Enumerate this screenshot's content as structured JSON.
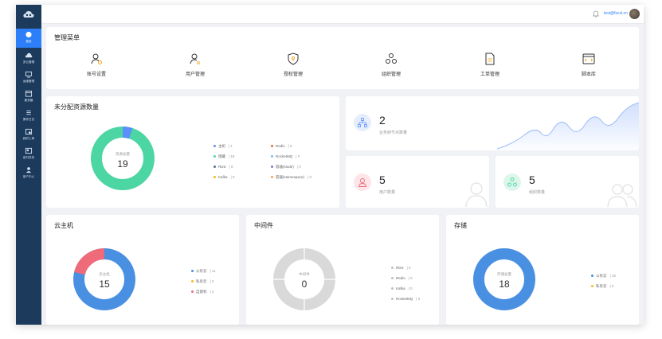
{
  "sidebar": {
    "items": [
      {
        "label": "首页",
        "icon": "home-icon",
        "active": true
      },
      {
        "label": "多云管理",
        "icon": "cloud-icon"
      },
      {
        "label": "运维管理",
        "icon": "monitor-icon"
      },
      {
        "label": "服务器",
        "icon": "calendar-icon"
      },
      {
        "label": "操作日志",
        "icon": "list-icon"
      },
      {
        "label": "我的工单",
        "icon": "ticket-icon"
      },
      {
        "label": "定时任务",
        "icon": "task-icon"
      },
      {
        "label": "用户中心",
        "icon": "user-icon"
      }
    ]
  },
  "header": {
    "username": "test@fscxl.cn"
  },
  "menu": {
    "title": "管理菜单",
    "items": [
      {
        "label": "账号设置",
        "icon": "account-settings-icon"
      },
      {
        "label": "用户管理",
        "icon": "user-manage-icon"
      },
      {
        "label": "授权管理",
        "icon": "shield-icon"
      },
      {
        "label": "组织管理",
        "icon": "org-icon"
      },
      {
        "label": "工单管理",
        "icon": "ticket-doc-icon"
      },
      {
        "label": "脚本库",
        "icon": "script-icon"
      }
    ]
  },
  "unassigned": {
    "title": "未分配资源数量",
    "center_label": "资源总量",
    "total": "19",
    "colors": {
      "main": "#4cd6a3",
      "secondary": "#5b8ff9"
    },
    "legend_left": [
      {
        "name": "主机",
        "value": "1",
        "color": "#5b8ff9"
      },
      {
        "name": "储藏",
        "value": "18",
        "color": "#4cd6a3"
      },
      {
        "name": "RDS",
        "value": "0",
        "color": "#5d7092"
      },
      {
        "name": "Kafka",
        "value": "0",
        "color": "#f6bd16"
      }
    ],
    "legend_right": [
      {
        "name": "Redis",
        "value": "0",
        "color": "#e8684a"
      },
      {
        "name": "RocketMQ",
        "value": "0",
        "color": "#6dc8ec"
      },
      {
        "name": "容器(Node)",
        "value": "0",
        "color": "#9270ca"
      },
      {
        "name": "容器(Namespace)",
        "value": "0",
        "color": "#ff9d4d"
      }
    ]
  },
  "stats": {
    "business_nodes": {
      "value": "2",
      "label": "业务树节点数量",
      "icon": "tree-icon",
      "color": "#5b8ff9"
    },
    "users": {
      "value": "5",
      "label": "用户数量",
      "icon": "user-icon",
      "color": "#f06b7a"
    },
    "orgs": {
      "value": "5",
      "label": "组织数量",
      "icon": "org-icon",
      "color": "#4cd6a3"
    }
  },
  "cloud_host": {
    "title": "云主机",
    "center_label": "云主机",
    "total": "15",
    "colors": {
      "main": "#4a90e2",
      "secondary": "#f06b7a"
    },
    "legend": [
      {
        "name": "公有云",
        "value": "11",
        "color": "#4a90e2"
      },
      {
        "name": "私有云",
        "value": "0",
        "color": "#f6bd16"
      },
      {
        "name": "自建机",
        "value": "4",
        "color": "#f06b7a"
      }
    ]
  },
  "middleware": {
    "title": "中间件",
    "center_label": "中间件",
    "total": "0",
    "colors": {
      "main": "#d9d9d9"
    },
    "legend": [
      {
        "name": "RDS",
        "value": "0",
        "color": "#bfbfbf"
      },
      {
        "name": "Redis",
        "value": "0",
        "color": "#bfbfbf"
      },
      {
        "name": "Kafka",
        "value": "0",
        "color": "#bfbfbf"
      },
      {
        "name": "RocketMQ",
        "value": "0",
        "color": "#bfbfbf"
      }
    ]
  },
  "storage": {
    "title": "存储",
    "center_label": "存储总量",
    "total": "18",
    "colors": {
      "main": "#4a90e2"
    },
    "legend": [
      {
        "name": "公有云",
        "value": "18",
        "color": "#4a90e2"
      },
      {
        "name": "私有云",
        "value": "0",
        "color": "#f6bd16"
      }
    ]
  }
}
